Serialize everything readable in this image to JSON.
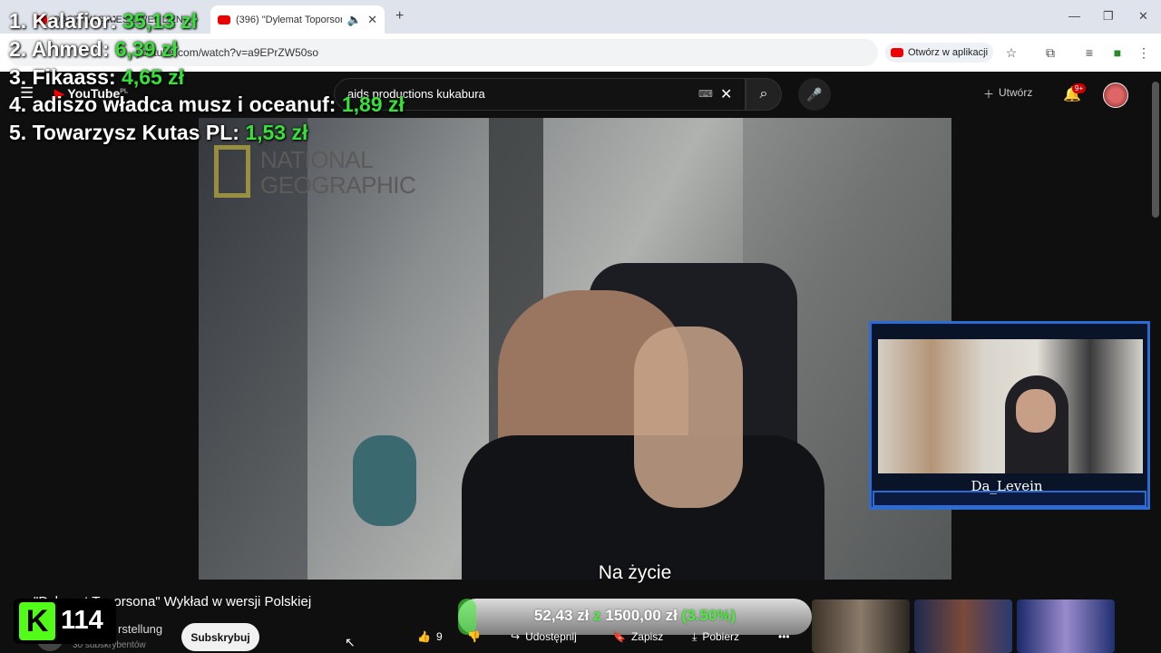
{
  "browser": {
    "tabs": [
      {
        "label": "OBST WAS MESZ WEL DEN..."
      },
      {
        "label": "(396) \"Dylemat Toporsona\""
      }
    ],
    "new_tab": "+",
    "url": "youtube.com/watch?v=a9EPrZW50so",
    "open_in_app": "Otwórz w aplikacji",
    "window_controls": {
      "minimize": "—",
      "maximize": "❐",
      "close": "✕"
    }
  },
  "youtube": {
    "logo": "YouTube",
    "region": "PL",
    "search_query": "aids productions kukabura",
    "create_label": "Utwórz",
    "notifications_badge": "9+"
  },
  "stream_overlay": {
    "leaderboard": [
      {
        "rank_name": "1. Kalafior:",
        "amount": "35,13 zł"
      },
      {
        "rank_name": "2. Ahmed:",
        "amount": "6,39 zł"
      },
      {
        "rank_name": "3. Fikaass:",
        "amount": "4,65 zł"
      },
      {
        "rank_name": "4. adiszo władca musz i oceanuf:",
        "amount": "1,89 zł"
      },
      {
        "rank_name": "5. Towarzysz Kutas PL:",
        "amount": "1,53 zł"
      }
    ],
    "watermark_line1": "NATIONAL",
    "watermark_line2": "GEOGRAPHIC",
    "subtitle": "Na życie",
    "cam_name": "Da_Levein",
    "kick_viewers": "114",
    "kick_logo": "K",
    "donation_goal": {
      "current": "52,43 zł",
      "separator": "z",
      "target": "1500,00 zł",
      "percent": "(3.50%)",
      "progress": 0.035
    }
  },
  "video_info": {
    "title": "\"Dylemat Toporsona\" Wykład w wersji Polskiej",
    "channel": "rstellung",
    "subscribers": "30 subskrybentów",
    "subscribe_label": "Subskrybuj",
    "likes": "9",
    "share_label": "Udostępnij",
    "save_label": "Zapisz",
    "download_label": "Pobierz",
    "more_label": "•••"
  }
}
